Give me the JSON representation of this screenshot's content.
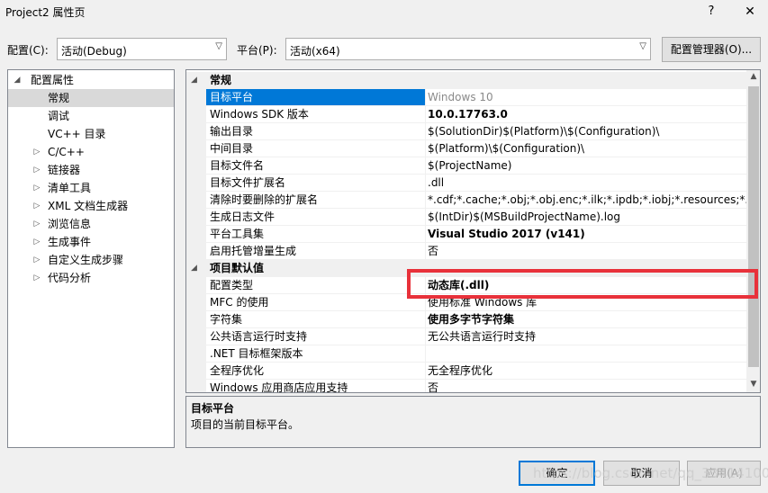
{
  "window": {
    "title": "Project2 属性页",
    "help_glyph": "?",
    "close_glyph": "✕"
  },
  "topbar": {
    "config_label": "配置(C):",
    "config_value": "活动(Debug)",
    "platform_label": "平台(P):",
    "platform_value": "活动(x64)",
    "config_manager_label": "配置管理器(O)..."
  },
  "tree": {
    "items": [
      {
        "label": "配置属性",
        "toggle": "◢"
      },
      {
        "label": "常规",
        "toggle": ""
      },
      {
        "label": "调试",
        "toggle": ""
      },
      {
        "label": "VC++ 目录",
        "toggle": ""
      },
      {
        "label": "C/C++",
        "toggle": "▷"
      },
      {
        "label": "链接器",
        "toggle": "▷"
      },
      {
        "label": "清单工具",
        "toggle": "▷"
      },
      {
        "label": "XML 文档生成器",
        "toggle": "▷"
      },
      {
        "label": "浏览信息",
        "toggle": "▷"
      },
      {
        "label": "生成事件",
        "toggle": "▷"
      },
      {
        "label": "自定义生成步骤",
        "toggle": "▷"
      },
      {
        "label": "代码分析",
        "toggle": "▷"
      }
    ],
    "selected": "常规"
  },
  "grid": {
    "categories": [
      {
        "label": "常规",
        "toggle": "◢"
      },
      {
        "label": "项目默认值",
        "toggle": "◢"
      }
    ],
    "general_rows": [
      {
        "name": "目标平台",
        "value": "Windows 10"
      },
      {
        "name": "Windows SDK 版本",
        "value": "10.0.17763.0"
      },
      {
        "name": "输出目录",
        "value": "$(SolutionDir)$(Platform)\\$(Configuration)\\"
      },
      {
        "name": "中间目录",
        "value": "$(Platform)\\$(Configuration)\\"
      },
      {
        "name": "目标文件名",
        "value": "$(ProjectName)"
      },
      {
        "name": "目标文件扩展名",
        "value": ".dll"
      },
      {
        "name": "清除时要删除的扩展名",
        "value": "*.cdf;*.cache;*.obj;*.obj.enc;*.ilk;*.ipdb;*.iobj;*.resources;*.tlb;*.t"
      },
      {
        "name": "生成日志文件",
        "value": "$(IntDir)$(MSBuildProjectName).log"
      },
      {
        "name": "平台工具集",
        "value": "Visual Studio 2017 (v141)"
      },
      {
        "name": "启用托管增量生成",
        "value": "否"
      }
    ],
    "default_rows": [
      {
        "name": "配置类型",
        "value": "动态库(.dll)"
      },
      {
        "name": "MFC 的使用",
        "value": "使用标准 Windows 库"
      },
      {
        "name": "字符集",
        "value": "使用多字节字符集"
      },
      {
        "name": "公共语言运行时支持",
        "value": "无公共语言运行时支持"
      },
      {
        "name": ".NET 目标框架版本",
        "value": ""
      },
      {
        "name": "全程序优化",
        "value": "无全程序优化"
      },
      {
        "name": "Windows 应用商店应用支持",
        "value": "否"
      }
    ]
  },
  "description": {
    "title": "目标平台",
    "text": "项目的当前目标平台。"
  },
  "buttons": {
    "ok": "确定",
    "cancel": "取消",
    "apply": "应用(A)"
  },
  "watermark": "https://blog.csdn.net/qq_33414100",
  "colors": {
    "selection": "#0078d7",
    "highlight_box": "#e8313a"
  }
}
